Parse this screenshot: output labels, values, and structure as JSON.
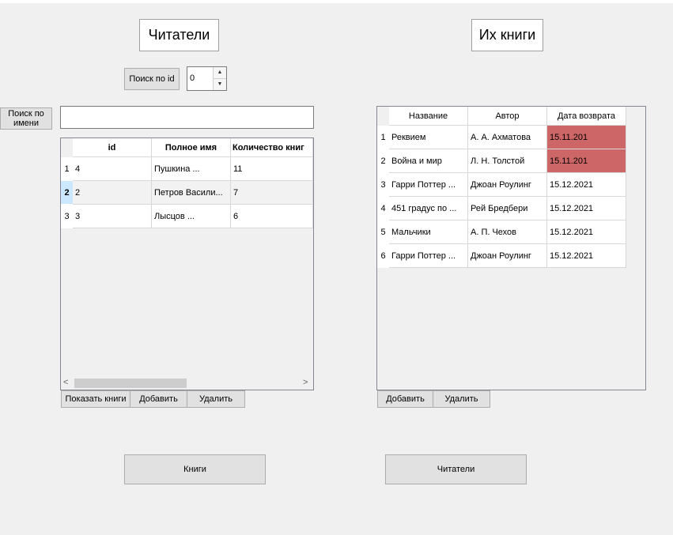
{
  "readers_panel": {
    "title": "Читатели",
    "search_id_label": "Поиск по id",
    "search_id_value": "0",
    "search_name_label": "Поиск по имени",
    "search_name_value": "",
    "columns": [
      "id",
      "Полное имя",
      "Количество книг"
    ],
    "rows": [
      {
        "num": "1",
        "id": "4",
        "name": "Пушкина ...",
        "count": "11",
        "selected": false
      },
      {
        "num": "2",
        "id": "2",
        "name": "Петров Васили...",
        "count": "7",
        "selected": true
      },
      {
        "num": "3",
        "id": "3",
        "name": "Лысцов ...",
        "count": "6",
        "selected": false
      }
    ],
    "buttons": {
      "show_books": "Показать книги",
      "add": "Добавить",
      "delete": "Удалить"
    },
    "nav_button": "Книги"
  },
  "books_panel": {
    "title": "Их книги",
    "columns": [
      "Название",
      "Автор",
      "Дата возврата"
    ],
    "rows": [
      {
        "num": "1",
        "title": "Реквием",
        "author": "А. А. Ахматова",
        "date": "15.11.201",
        "overdue": true
      },
      {
        "num": "2",
        "title": "Война и мир",
        "author": "Л. Н. Толстой",
        "date": "15.11.201",
        "overdue": true
      },
      {
        "num": "3",
        "title": "Гарри Поттер ...",
        "author": "Джоан Роулинг",
        "date": "15.12.2021",
        "overdue": false
      },
      {
        "num": "4",
        "title": "451 градус по ...",
        "author": "Рей Бредбери",
        "date": "15.12.2021",
        "overdue": false
      },
      {
        "num": "5",
        "title": "Мальчики",
        "author": "А. П. Чехов",
        "date": "15.12.2021",
        "overdue": false
      },
      {
        "num": "6",
        "title": "Гарри Поттер ...",
        "author": "Джоан Роулинг",
        "date": "15.12.2021",
        "overdue": false
      }
    ],
    "buttons": {
      "add": "Добавить",
      "delete": "Удалить"
    },
    "nav_button": "Читатели"
  },
  "icons": {
    "spin_up": "▲",
    "spin_down": "▼",
    "scroll_left": "<",
    "scroll_right": ">"
  },
  "colors": {
    "overdue": "#cd6666",
    "selected_row_header": "#cce8ff"
  }
}
